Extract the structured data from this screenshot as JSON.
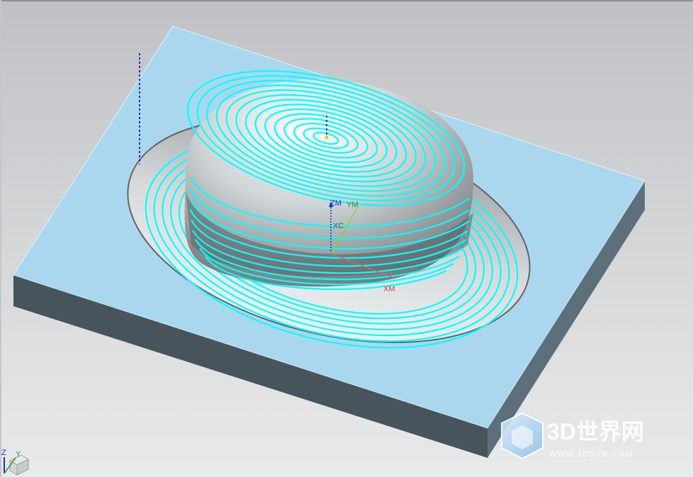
{
  "viewport": {
    "background_top": "#bfc1c4",
    "background_bottom": "#e9eaeb"
  },
  "part": {
    "top_face_color": "#aad7ee",
    "side_front_color": "#48545c",
    "side_right_color": "#5c6f7b",
    "toolpath_color": "#00ffff",
    "surface_color": "#c8ccce"
  },
  "csys": {
    "zm_label": "ZM",
    "ym_label": "YM",
    "xc_label": "XC",
    "xm_label": "XM"
  },
  "triad": {
    "z_label": "Z",
    "y_label": "Y"
  },
  "watermark": {
    "title": "3D世界网",
    "url": "WWW.3DSJW.COM"
  }
}
